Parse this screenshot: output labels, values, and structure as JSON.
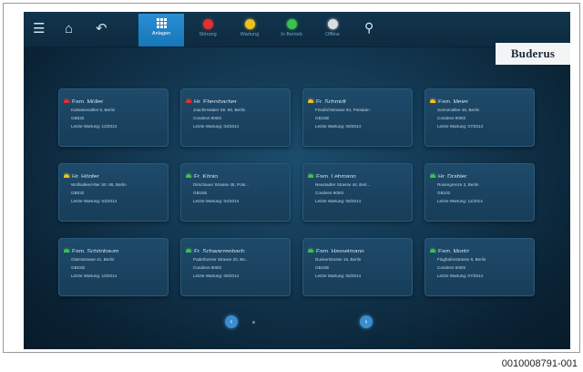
{
  "header": {
    "tabs": [
      {
        "label": "Anlagen",
        "icon": "grid-icon",
        "color": "#ffffff",
        "active": true
      },
      {
        "label": "Störung",
        "icon": "red-status-icon",
        "color": "#e03030",
        "active": false
      },
      {
        "label": "Wartung",
        "icon": "yellow-status-icon",
        "color": "#f0c020",
        "active": false
      },
      {
        "label": "In Betrieb",
        "icon": "green-status-icon",
        "color": "#3cc050",
        "active": false
      },
      {
        "label": "Offline",
        "icon": "grey-status-icon",
        "color": "#d8dde2",
        "active": false
      }
    ],
    "logo": "Buderus"
  },
  "cards": [
    {
      "name": "Fam. Müller",
      "status": "#e03030",
      "line1": "Kastanienallee 9, Berlin",
      "line2": "GB032",
      "line3": "Letzte Wartung: 12/2013"
    },
    {
      "name": "Hr. Ebersbacher",
      "status": "#e03030",
      "line1": "Joachimstaler Str. 56, Berlin",
      "line2": "Condens 9000i",
      "line3": "Letzte Wartung: 04/2014"
    },
    {
      "name": "Fr. Schmidt",
      "status": "#f0c020",
      "line1": "Friedrichstrasse 54, Potsdam",
      "line2": "GB192i",
      "line3": "Letzte Wartung: 08/2014"
    },
    {
      "name": "Fam. Meier",
      "status": "#f0c020",
      "line1": "Sonnenallee 45, Berlin",
      "line2": "Condens 9000i",
      "line3": "Letzte Wartung: 07/2014"
    },
    {
      "name": "Hr. Höpfer",
      "status": "#f0c020",
      "line1": "Wolfsallee/Alter Str. 86, Berlin",
      "line2": "GB032",
      "line3": "Letzte Wartung: 03/2014"
    },
    {
      "name": "Fr. König",
      "status": "#3cc050",
      "line1": "Dirschauer Strasse 45, Pots...",
      "line2": "GB192i",
      "line3": "Letzte Wartung: 04/2014"
    },
    {
      "name": "Fam. Lehmann",
      "status": "#3cc050",
      "line1": "Neustadter Strasse 44, Berl...",
      "line2": "Condens 9000i",
      "line3": "Letzte Wartung: 08/2014"
    },
    {
      "name": "Hr. Drahler",
      "status": "#3cc050",
      "line1": "Rosengrenze 3, Berlin",
      "line2": "GB102",
      "line3": "Letzte Wartung: 11/2014"
    },
    {
      "name": "Fam. Schönbaum",
      "status": "#3cc050",
      "line1": "Gleimstrasse 41, Berlin",
      "line2": "GB192i",
      "line3": "Letzte Wartung: 10/2014"
    },
    {
      "name": "Fr. Schwarzenbach",
      "status": "#3cc050",
      "line1": "Paderborner Strasse 20, Be...",
      "line2": "Condens 9000i",
      "line3": "Letzte Wartung: 06/2014"
    },
    {
      "name": "Fam. Hasselmann",
      "status": "#3cc050",
      "line1": "Dunkerstrasse 15, Berlin",
      "line2": "GB192i",
      "line3": "Letzte Wartung: 05/2014"
    },
    {
      "name": "Fam. Moritz",
      "status": "#3cc050",
      "line1": "Flughafenstrasse 9, Berlin",
      "line2": "Condens 5000i",
      "line3": "Letzte Wartung: 07/2014"
    }
  ],
  "pagination": {
    "prev": "‹",
    "next": "›"
  },
  "caption": "0010008791-001"
}
